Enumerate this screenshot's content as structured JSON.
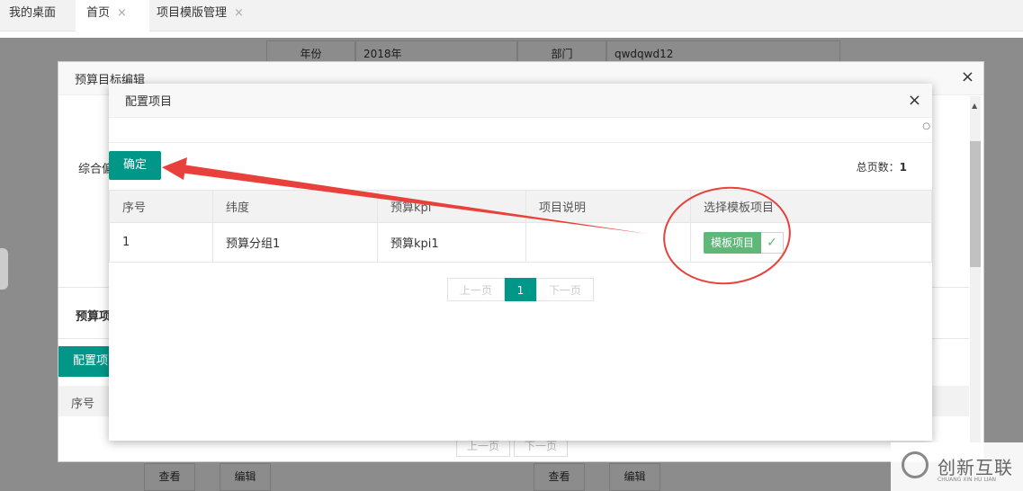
{
  "tabs": [
    {
      "label": "我的桌面",
      "closable": false
    },
    {
      "label": "首页",
      "closable": true
    },
    {
      "label": "项目模版管理",
      "closable": true
    }
  ],
  "close_glyph": "×",
  "background_form": {
    "year_label": "年份",
    "year_value": "2018年",
    "dept_label": "部门",
    "dept_value": "qwdqwd12",
    "view_label": "查看",
    "edit_label": "编辑"
  },
  "outer_modal": {
    "title": "预算目标编辑",
    "side_label_1": "综合偏",
    "section_label": "预算项",
    "config_button": "配置项",
    "col_seq": "序号",
    "prev": "上一页",
    "next": "下一页"
  },
  "inner_modal": {
    "title": "配置项目",
    "confirm_label": "确定",
    "total_pages_label": "总页数：",
    "total_pages_value": "1",
    "columns": [
      "序号",
      "纬度",
      "预算kpi",
      "项目说明",
      "选择模板项目"
    ],
    "rows": [
      {
        "seq": "1",
        "dimension": "预算分组1",
        "kpi": "预算kpi1",
        "desc": "",
        "template_label": "模板项目",
        "checked": true
      }
    ],
    "pager": {
      "prev": "上一页",
      "current": "1",
      "next": "下一页"
    }
  },
  "watermark": {
    "text": "创新互联",
    "sub": "CHUANG XIN HU LIAN"
  },
  "colors": {
    "primary": "#009688",
    "success": "#5fb878",
    "annotation": "#e8413b"
  }
}
